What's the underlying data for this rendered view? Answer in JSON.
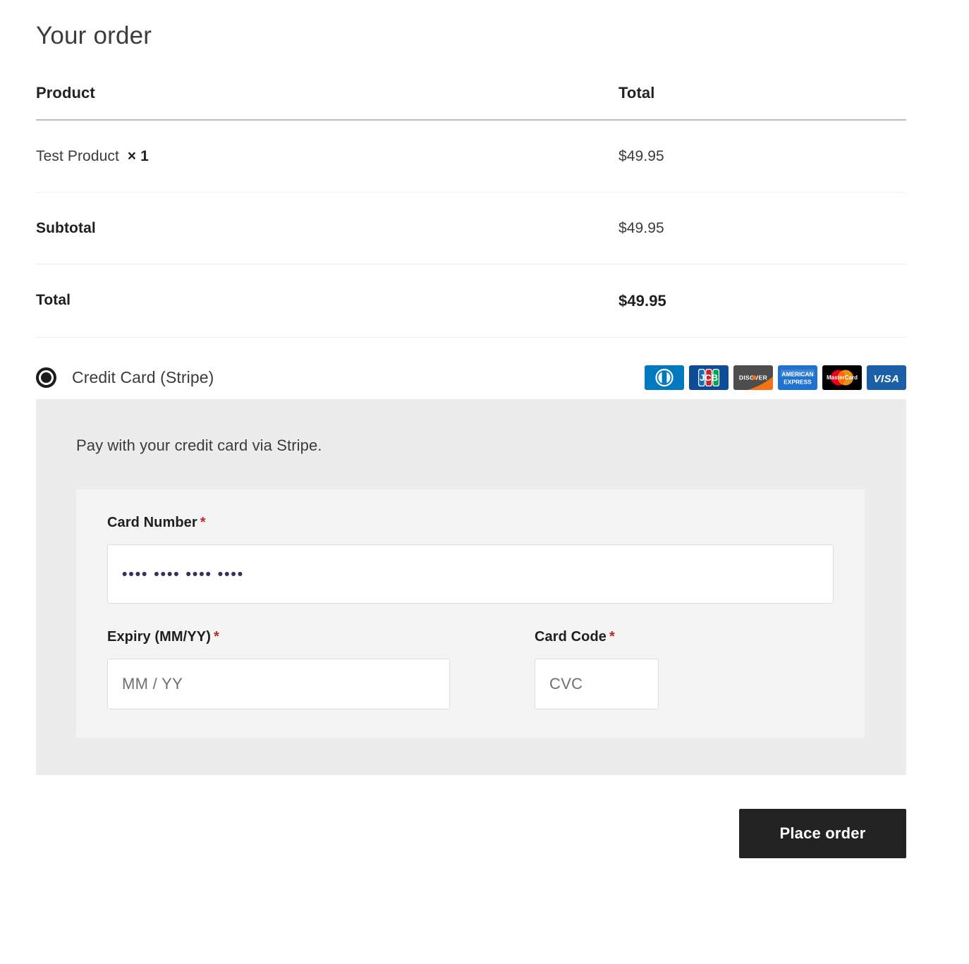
{
  "page": {
    "title": "Your order"
  },
  "order_table": {
    "headers": {
      "product": "Product",
      "total": "Total"
    },
    "rows": [
      {
        "type": "item",
        "name": "Test Product",
        "qty": "× 1",
        "total": "$49.95"
      },
      {
        "type": "subtotal",
        "label": "Subtotal",
        "total": "$49.95"
      },
      {
        "type": "total",
        "label": "Total",
        "total": "$49.95"
      }
    ]
  },
  "payment": {
    "method": {
      "label": "Credit Card (Stripe)",
      "selected": true,
      "radio_name": "payment-method-radio"
    },
    "accepted_cards": [
      {
        "name": "diners-club",
        "label": "Diners Club",
        "color": "#0079be"
      },
      {
        "name": "jcb",
        "label": "JCB",
        "color": "#0e4c96"
      },
      {
        "name": "discover",
        "label": "DISCOVER",
        "color": "#4d4d4d",
        "accent": "#f47216"
      },
      {
        "name": "american-express",
        "label": "AMERICAN EXPRESS",
        "color": "#1f72cd"
      },
      {
        "name": "mastercard",
        "label": "MasterCard",
        "color": "#000000",
        "accent": "#eb001b"
      },
      {
        "name": "visa",
        "label": "VISA",
        "color": "#1a5fa8"
      }
    ],
    "description": "Pay with your credit card via Stripe.",
    "fields": {
      "card_number": {
        "label": "Card Number",
        "required_marker": "*",
        "value": "•••• •••• •••• ••••"
      },
      "expiry": {
        "label": "Expiry (MM/YY)",
        "required_marker": "*",
        "placeholder": "MM / YY",
        "value": ""
      },
      "card_code": {
        "label": "Card Code",
        "required_marker": "*",
        "placeholder": "CVC",
        "value": ""
      }
    }
  },
  "actions": {
    "place_order": "Place order"
  },
  "colors": {
    "button_bg": "#222222",
    "required_asterisk": "#c1272d",
    "panel_bg": "#ececec",
    "form_bg": "#f4f4f4"
  }
}
